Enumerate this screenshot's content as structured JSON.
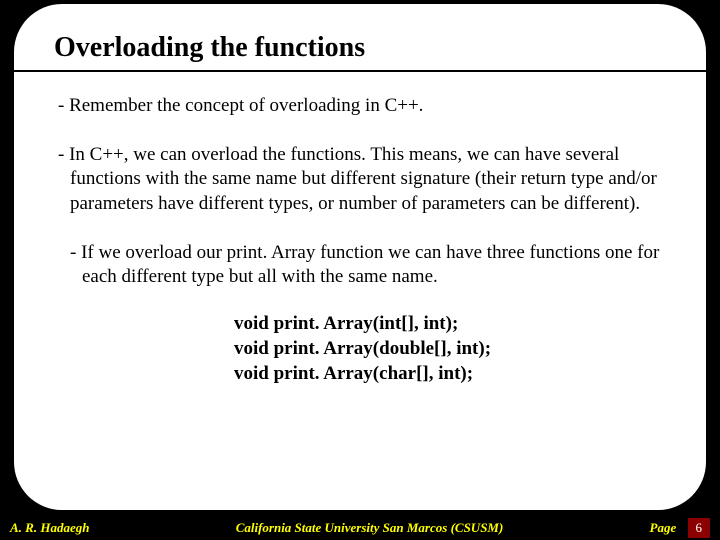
{
  "title": "Overloading the functions",
  "bullets": {
    "b1": "- Remember the concept of overloading in C++.",
    "b2": "- In C++, we can overload the functions. This means, we can have several functions with the same name but different signature (their return type and/or parameters have different types, or number of parameters can be different).",
    "b3": "- If we overload our print. Array function we can have three functions one for each different type but all with the same name."
  },
  "code": {
    "line1": "void print. Array(int[], int);",
    "line2": "void print. Array(double[], int);",
    "line3": "void print. Array(char[], int);"
  },
  "footer": {
    "left": "A. R. Hadaegh",
    "center": "California State University San Marcos (CSUSM)",
    "pagelabel": "Page",
    "pagenum": "6"
  }
}
